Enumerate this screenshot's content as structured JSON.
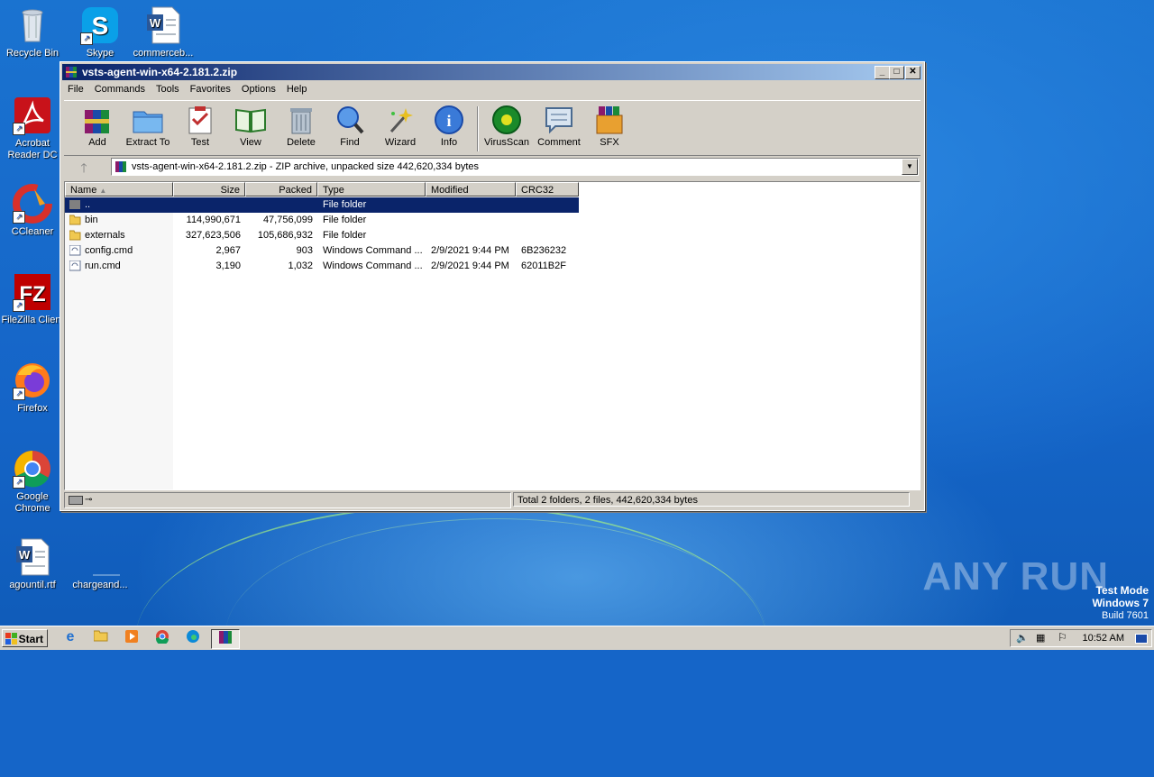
{
  "desktop": {
    "icons": [
      {
        "label": "Recycle Bin"
      },
      {
        "label": "Skype"
      },
      {
        "label": "commerceb..."
      },
      {
        "label": "Acrobat Reader DC"
      },
      {
        "label": "CCleaner"
      },
      {
        "label": "FileZilla Client"
      },
      {
        "label": "Firefox"
      },
      {
        "label": "Google Chrome"
      },
      {
        "label": "agountil.rtf"
      },
      {
        "label": "chargeand..."
      }
    ],
    "watermark": "ANY RUN",
    "test_mode": {
      "line1": "Test Mode",
      "line2": "Windows 7",
      "line3": "Build 7601"
    }
  },
  "window": {
    "title": "vsts-agent-win-x64-2.181.2.zip",
    "controls": {
      "minimize": "_",
      "maximize": "□",
      "close": "✕"
    },
    "menu": [
      "File",
      "Commands",
      "Tools",
      "Favorites",
      "Options",
      "Help"
    ],
    "toolbar": [
      {
        "label": "Add",
        "icon": "add-archive-icon"
      },
      {
        "label": "Extract To",
        "icon": "extract-folder-icon"
      },
      {
        "label": "Test",
        "icon": "test-clipboard-icon"
      },
      {
        "label": "View",
        "icon": "view-book-icon"
      },
      {
        "label": "Delete",
        "icon": "trash-icon"
      },
      {
        "label": "Find",
        "icon": "magnifier-icon"
      },
      {
        "label": "Wizard",
        "icon": "wand-icon"
      },
      {
        "label": "Info",
        "icon": "info-icon"
      },
      {
        "label": "VirusScan",
        "icon": "virus-scan-icon"
      },
      {
        "label": "Comment",
        "icon": "comment-icon"
      },
      {
        "label": "SFX",
        "icon": "sfx-box-icon"
      }
    ],
    "address": "vsts-agent-win-x64-2.181.2.zip - ZIP archive, unpacked size 442,620,334 bytes",
    "columns": {
      "name": "Name",
      "size": "Size",
      "packed": "Packed",
      "type": "Type",
      "modified": "Modified",
      "crc": "CRC32"
    },
    "rows": [
      {
        "name": "..",
        "size": "",
        "packed": "",
        "type": "File folder",
        "modified": "",
        "crc": "",
        "kind": "up"
      },
      {
        "name": "bin",
        "size": "114,990,671",
        "packed": "47,756,099",
        "type": "File folder",
        "modified": "",
        "crc": "",
        "kind": "folder"
      },
      {
        "name": "externals",
        "size": "327,623,506",
        "packed": "105,686,932",
        "type": "File folder",
        "modified": "",
        "crc": "",
        "kind": "folder"
      },
      {
        "name": "config.cmd",
        "size": "2,967",
        "packed": "903",
        "type": "Windows Command ...",
        "modified": "2/9/2021 9:44 PM",
        "crc": "6B236232",
        "kind": "cmd"
      },
      {
        "name": "run.cmd",
        "size": "3,190",
        "packed": "1,032",
        "type": "Windows Command ...",
        "modified": "2/9/2021 9:44 PM",
        "crc": "62011B2F",
        "kind": "cmd"
      }
    ],
    "status": "Total 2 folders, 2 files, 442,620,334 bytes"
  },
  "taskbar": {
    "start_label": "Start",
    "clock": "10:52 AM"
  }
}
